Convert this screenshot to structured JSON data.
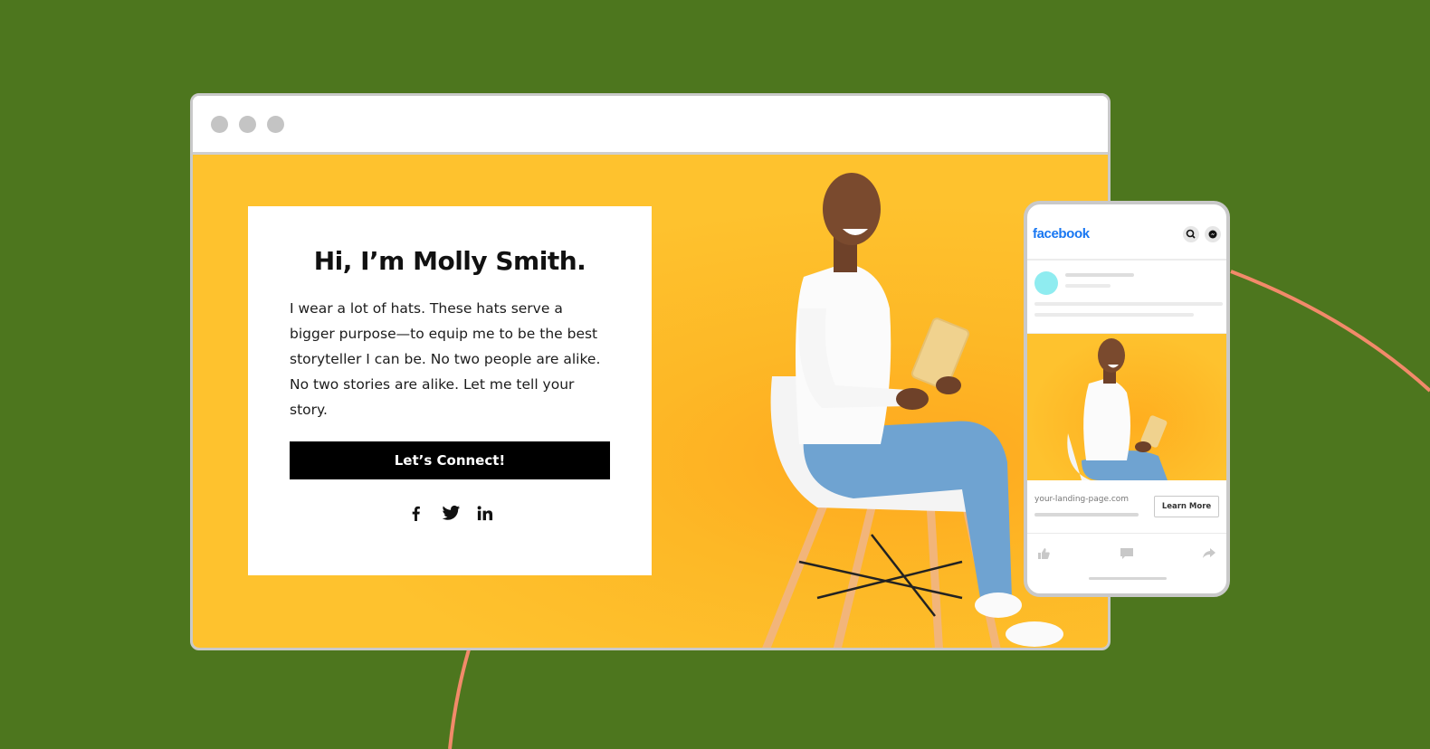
{
  "colors": {
    "background": "#4d761e",
    "accent_line": "#f28a6a",
    "hero_yellow": "#fec22e",
    "button_black": "#000000",
    "facebook_blue": "#1877f2"
  },
  "browser": {
    "window_controls": [
      "close-dot",
      "minimize-dot",
      "maximize-dot"
    ]
  },
  "landing": {
    "title": "Hi, I’m Molly Smith.",
    "body": "I wear a lot of hats. These hats serve a bigger purpose—to equip me to be the best storyteller I can be. No two people are alike. No two stories are alike. Let me tell your story.",
    "cta_label": "Let’s Connect!",
    "social_icons": [
      "facebook-icon",
      "twitter-icon",
      "linkedin-icon"
    ]
  },
  "phone": {
    "app_name": "facebook",
    "header_icons": [
      "search-icon",
      "messenger-icon"
    ],
    "link_url": "your-landing-page.com",
    "link_button": "Learn More",
    "action_icons": [
      "like-icon",
      "comment-icon",
      "share-icon"
    ]
  }
}
